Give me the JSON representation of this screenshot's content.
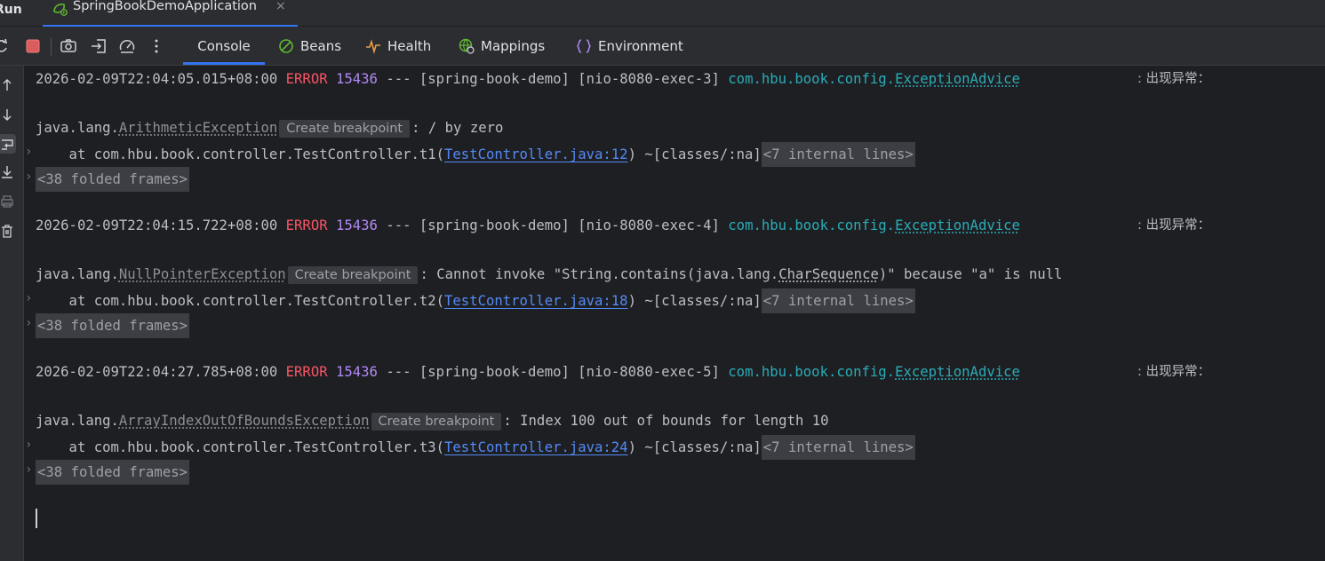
{
  "run_window": {
    "title": "Run",
    "tab": {
      "label": "SpringBookDemoApplication",
      "close": "×"
    }
  },
  "toolbar": {
    "tabs": [
      {
        "label": "Console",
        "icon": "console",
        "active": true
      },
      {
        "label": "Beans",
        "icon": "beans-icon"
      },
      {
        "label": "Health",
        "icon": "health-icon"
      },
      {
        "label": "Mappings",
        "icon": "mappings-icon"
      },
      {
        "label": "Environment",
        "icon": "environment-icon"
      }
    ]
  },
  "console": {
    "entries": [
      {
        "timestamp": "2026-02-09T22:04:05.015+08:00",
        "level": "ERROR",
        "pid": "15436",
        "sep": "---",
        "app": "[spring-book-demo]",
        "thread": "[nio-8080-exec-3]",
        "logger_pkg": "com.hbu.book.config.",
        "logger_class": "ExceptionAdvice",
        "message": ": 出现异常：",
        "exception_pkg": "java.lang.",
        "exception_class": "ArithmeticException",
        "breakpoint_hint": "Create breakpoint",
        "exception_message": ": / by zero",
        "frame_prefix": "    at com.hbu.book.controller.TestController.t1(",
        "frame_link": "TestController.java:12",
        "frame_suffix": ") ~[classes/:na]",
        "internal_lines": "<7 internal lines>",
        "folded_frames": "<38 folded frames>"
      },
      {
        "timestamp": "2026-02-09T22:04:15.722+08:00",
        "level": "ERROR",
        "pid": "15436",
        "sep": "---",
        "app": "[spring-book-demo]",
        "thread": "[nio-8080-exec-4]",
        "logger_pkg": "com.hbu.book.config.",
        "logger_class": "ExceptionAdvice",
        "message": ": 出现异常：",
        "exception_pkg": "java.lang.",
        "exception_class": "NullPointerException",
        "breakpoint_hint": "Create breakpoint",
        "exception_message_pre": ": Cannot invoke \"String.contains(java.lang.",
        "exception_message_mid": "CharSequence",
        "exception_message_post": ")\" because \"a\" is null",
        "frame_prefix": "    at com.hbu.book.controller.TestController.t2(",
        "frame_link": "TestController.java:18",
        "frame_suffix": ") ~[classes/:na]",
        "internal_lines": "<7 internal lines>",
        "folded_frames": "<38 folded frames>"
      },
      {
        "timestamp": "2026-02-09T22:04:27.785+08:00",
        "level": "ERROR",
        "pid": "15436",
        "sep": "---",
        "app": "[spring-book-demo]",
        "thread": "[nio-8080-exec-5]",
        "logger_pkg": "com.hbu.book.config.",
        "logger_class": "ExceptionAdvice",
        "message": ": 出现异常：",
        "exception_pkg": "java.lang.",
        "exception_class": "ArrayIndexOutOfBoundsException",
        "breakpoint_hint": "Create breakpoint",
        "exception_message": ": Index 100 out of bounds for length 10",
        "frame_prefix": "    at com.hbu.book.controller.TestController.t3(",
        "frame_link": "TestController.java:24",
        "frame_suffix": ") ~[classes/:na]",
        "internal_lines": "<7 internal lines>",
        "folded_frames": "<38 folded frames>"
      }
    ]
  },
  "colors": {
    "background": "#1e1f22",
    "panel": "#2b2d30",
    "accent": "#3574f0",
    "error": "#f75464",
    "pid": "#b189f5",
    "logger": "#2aacb8",
    "link": "#548af7"
  }
}
